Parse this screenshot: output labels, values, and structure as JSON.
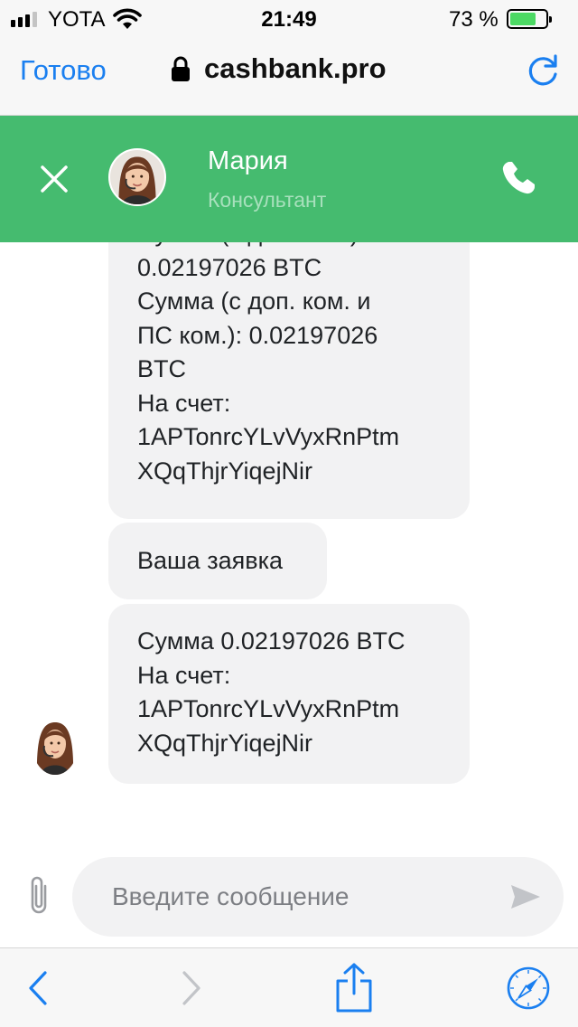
{
  "status_bar": {
    "carrier": "YOTA",
    "time": "21:49",
    "battery_percent": "73 %",
    "battery_level": 0.73,
    "signal_bars_filled": 3,
    "signal_bars_total": 4
  },
  "browser": {
    "done_label": "Готово",
    "url": "cashbank.pro",
    "accent_color": "#1a7ff0"
  },
  "chat_header": {
    "agent_name": "Мария",
    "agent_role": "Консультант",
    "background_color": "#45bb6f",
    "icons": [
      "close-icon",
      "avatar",
      "phone-icon"
    ]
  },
  "messages": [
    {
      "lines": [
        "Сумма (с доп. ком.):",
        "0.02197026 BTC",
        "Сумма (с доп. ком. и",
        "ПС ком.): 0.02197026",
        "BTC",
        "На счет:",
        "1APTonrcYLvVyxRnPtm",
        "XQqThjrYiqejNir"
      ]
    },
    {
      "lines": [
        "Ваша заявка"
      ]
    },
    {
      "lines": [
        "Сумма 0.02197026 BTC",
        "На счет:",
        "1APTonrcYLvVyxRnPtm",
        "XQqThjrYiqejNir"
      ]
    }
  ],
  "composer": {
    "placeholder": "Введите сообщение",
    "value": "",
    "icons": [
      "paperclip-icon",
      "send-icon"
    ]
  },
  "toolbar": {
    "icons": [
      "back-icon",
      "forward-icon",
      "share-icon",
      "safari-compass-icon"
    ]
  }
}
